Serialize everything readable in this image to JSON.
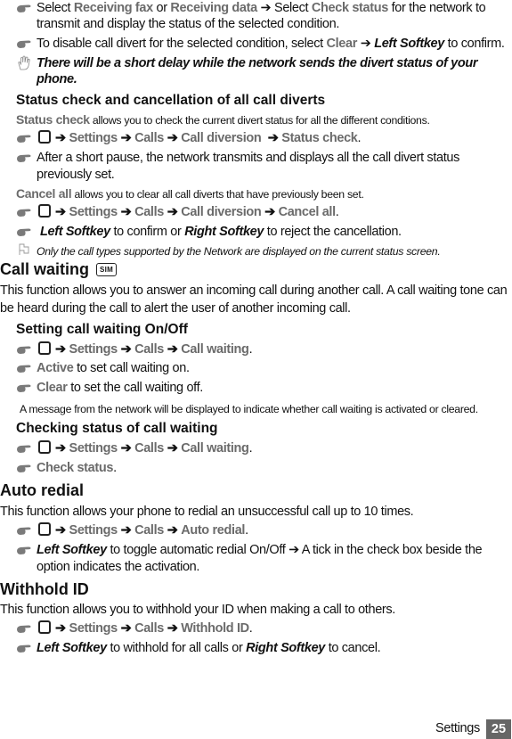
{
  "lines": {
    "l1": {
      "a": "Select ",
      "b": "Receiving fax",
      "c": " or ",
      "d": "Receiving data",
      "e": " ➔ Select ",
      "f": "Check status",
      "g": " for the network to"
    },
    "l2": "transmit and display the status of the selected condition.",
    "l3": {
      "a": "To disable call divert for the selected condition, select ",
      "b": "Clear",
      "c": " ➔ ",
      "d": "Left Softkey",
      "e": " to confirm."
    },
    "note1a": "There will be a short delay while the network sends the divert status of your",
    "note1b": "phone.",
    "h_status": "Status check and cancellation of all call diverts",
    "status_desc": {
      "a": "Status check",
      "b": " allows you to check the current divert status for all the different conditions."
    },
    "path1": {
      "a": "Settings",
      "b": "Calls",
      "c": "Call diversion",
      "d": "Status check",
      "end": "."
    },
    "after1": "After a short pause, the network transmits and displays all the call divert status",
    "after2": "previously set.",
    "cancel_desc": {
      "a": "Cancel all",
      "b": " allows you to clear all call diverts that have previously been set."
    },
    "path2": {
      "a": "Settings",
      "b": "Calls",
      "c": "Call diversion",
      "d": "Cancel all",
      "end": "."
    },
    "confirm": {
      "a": "Left Softkey",
      "b": " to confirm or ",
      "c": "Right Softkey",
      "d": " to reject the cancellation."
    },
    "note2": "Only the call types supported by the Network are displayed on the current status screen.",
    "h_callwaiting": "Call waiting",
    "sim_badge": "SIM",
    "cw_desc1": "This function allows you to answer an incoming call during another call. A call waiting tone can",
    "cw_desc2": "be heard during the call to alert the user of another incoming call.",
    "h_setting_cw": "Setting call waiting On/Off",
    "path3": {
      "a": "Settings",
      "b": "Calls",
      "c": "Call waiting",
      "end": "."
    },
    "active": {
      "a": "Active",
      "b": " to set call waiting on."
    },
    "clear": {
      "a": "Clear",
      "b": " to set the call waiting off."
    },
    "cw_msg": "A message from the network will be displayed to indicate whether call waiting is activated or cleared.",
    "h_checking_cw": "Checking status of call waiting",
    "path4": {
      "a": "Settings",
      "b": "Calls",
      "c": "Call waiting",
      "end": "."
    },
    "check_status": {
      "a": "Check status",
      "b": "."
    },
    "h_autoredial": "Auto redial",
    "ar_desc": "This function allows your phone to redial an unsuccessful call up to 10 times.",
    "path5": {
      "a": "Settings",
      "b": "Calls",
      "c": "Auto redial",
      "end": "."
    },
    "ar_toggle1": {
      "a": "Left Softkey",
      "b": " to toggle automatic redial On/Off ➔ A tick in the check box beside the"
    },
    "ar_toggle2": "option indicates the activation.",
    "h_withhold": "Withhold ID",
    "wh_desc": "This function allows you to withhold your ID when making a call to others.",
    "path6": {
      "a": "Settings",
      "b": "Calls",
      "c": "Withhold ID",
      "end": "."
    },
    "wh_softkey": {
      "a": "Left Softkey",
      "b": " to withhold for all calls or ",
      "c": "Right Softkey",
      "d": " to cancel."
    }
  },
  "footer": {
    "section": "Settings",
    "page": "25"
  },
  "icons": {
    "bullet": "pointing-hand",
    "menu": "menu-key",
    "note": "hand",
    "info": "flag",
    "arrow": "➔"
  }
}
